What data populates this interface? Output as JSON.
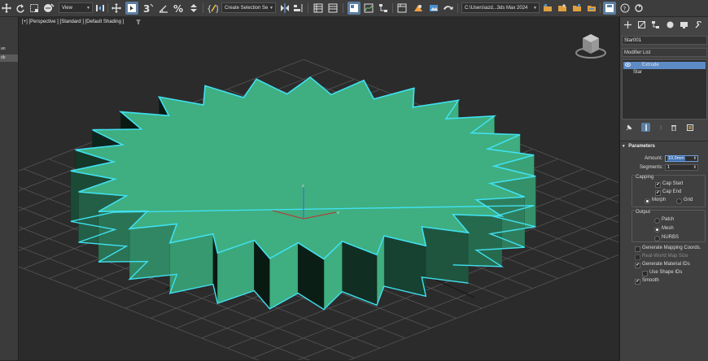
{
  "toolbar": {
    "view_dropdown": "View",
    "selection_set_dropdown": "Create Selection Se",
    "project_path_dropdown": "C:\\Users\\azd...3ds Max 2024"
  },
  "left_panel": {
    "items": [
      "an",
      "db"
    ]
  },
  "viewport": {
    "label": "[+] [Perspective ] [Standard ] [Default Shading ]",
    "filter_icon": "funnel-icon",
    "axis_labels": {
      "z": "z",
      "x": "x",
      "y": "y"
    },
    "object_color": "#3fae80",
    "selection_color": "#40e0f0"
  },
  "command_panel": {
    "object_name": "Star001",
    "modifier_list_label": "Modifier List",
    "stack": [
      {
        "label": "Extrude",
        "selected": true
      },
      {
        "label": "Star",
        "selected": false
      }
    ],
    "parameters": {
      "title": "Parameters",
      "amount_label": "Amount:",
      "amount_value": "10,0mm",
      "segments_label": "Segments:",
      "segments_value": "1",
      "capping": {
        "title": "Capping",
        "cap_start": {
          "label": "Cap Start",
          "checked": true
        },
        "cap_end": {
          "label": "Cap End",
          "checked": true
        },
        "morph": {
          "label": "Morph",
          "selected": true
        },
        "grid": {
          "label": "Grid",
          "selected": false
        }
      },
      "output": {
        "title": "Output",
        "patch": {
          "label": "Patch",
          "selected": false
        },
        "mesh": {
          "label": "Mesh",
          "selected": true
        },
        "nurbs": {
          "label": "NURBS",
          "selected": false
        }
      },
      "generate_mapping": {
        "label": "Generate Mapping Coords.",
        "checked": false
      },
      "real_world": {
        "label": "Real-World Map Size",
        "checked": false
      },
      "generate_material": {
        "label": "Generate Material IDs",
        "checked": true
      },
      "use_shape_ids": {
        "label": "Use Shape IDs",
        "checked": false
      },
      "smooth": {
        "label": "Smooth",
        "checked": true
      }
    }
  }
}
